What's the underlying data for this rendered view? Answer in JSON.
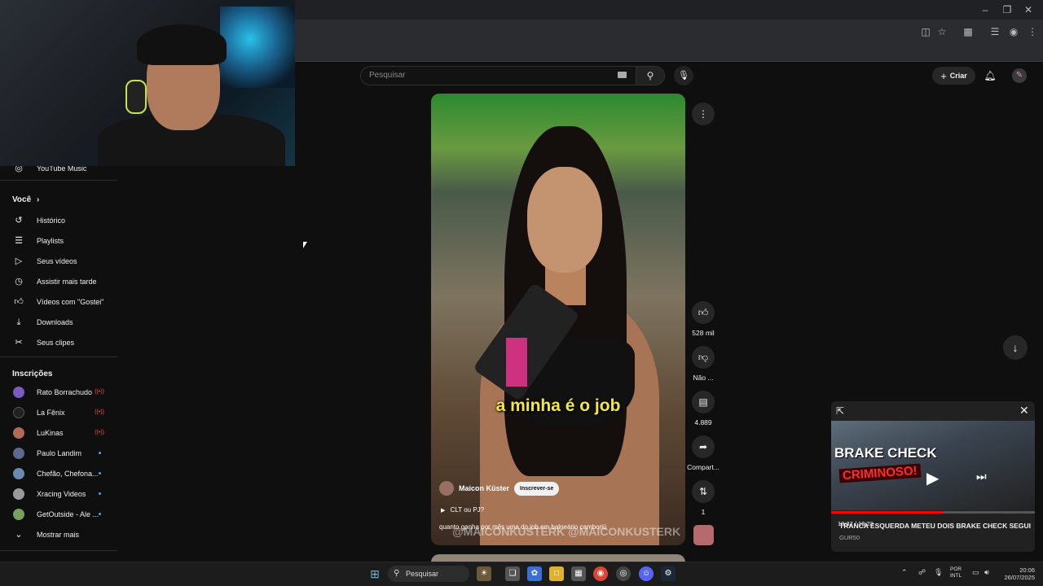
{
  "sidebar": {
    "youtube_music": "YouTube Music",
    "you_heading": "Você",
    "you_items": [
      {
        "label": "Histórico",
        "icon": "history-icon"
      },
      {
        "label": "Playlists",
        "icon": "playlists-icon"
      },
      {
        "label": "Seus vídeos",
        "icon": "your-videos-icon"
      },
      {
        "label": "Assistir mais tarde",
        "icon": "watch-later-icon"
      },
      {
        "label": "Vídeos com \"Gostei\"",
        "icon": "liked-icon"
      },
      {
        "label": "Downloads",
        "icon": "download-icon"
      },
      {
        "label": "Seus clipes",
        "icon": "clips-icon"
      }
    ],
    "subs_heading": "Inscrições",
    "subscriptions": [
      {
        "label": "Rato Borrachudo",
        "live": true,
        "color": "#7a5cc0"
      },
      {
        "label": "La Fênix",
        "live": true,
        "color": "#222222"
      },
      {
        "label": "LuKinas",
        "live": true,
        "color": "#b06a5a"
      },
      {
        "label": "Paulo Landim",
        "live": false,
        "color": "#5a6a8a"
      },
      {
        "label": "Chefão, Chefona...",
        "live": false,
        "color": "#6a8ab0"
      },
      {
        "label": "Xracing Videos",
        "live": false,
        "color": "#9a9a9a"
      },
      {
        "label": "GetOutside - Ale ...",
        "live": false,
        "color": "#7aa060"
      }
    ],
    "show_more": "Mostrar mais",
    "live_indicator": "((•))"
  },
  "header": {
    "search_placeholder": "Pesquisar",
    "create_label": "Criar"
  },
  "short": {
    "caption": "a minha é o job",
    "channel_name": "Maicon Küster",
    "subscribe_label": "Inscrever-se",
    "playlist_label": "CLT ou PJ?",
    "title": "quanto ganha por mês uma do job em balneário camboriú",
    "watermark": "@MAICONKUSTERK   @MAICONKUSTERK"
  },
  "actions": {
    "likes": "528 mil",
    "dislike": "Não ...",
    "comments": "4.889",
    "share": "Compart...",
    "remix": "1"
  },
  "miniplayer": {
    "overlay_line1": "BRAKE CHECK",
    "overlay_line2": "CRIMINOSO!",
    "time": "10:37 / 19:23",
    "progress": 0.548,
    "title": "TRANCA ESQUERDA METEU DOIS BRAKE CHECK SEGUI...",
    "channel": "GUR50"
  },
  "taskbar": {
    "search_label": "Pesquisar",
    "lang_line1": "POR",
    "lang_line2": "INTL",
    "time": "20:06",
    "date": "26/07/2025"
  },
  "colors": {
    "background": "#0f0f0f",
    "caption": "#f4e93a",
    "accent_red": "#ff0000"
  }
}
